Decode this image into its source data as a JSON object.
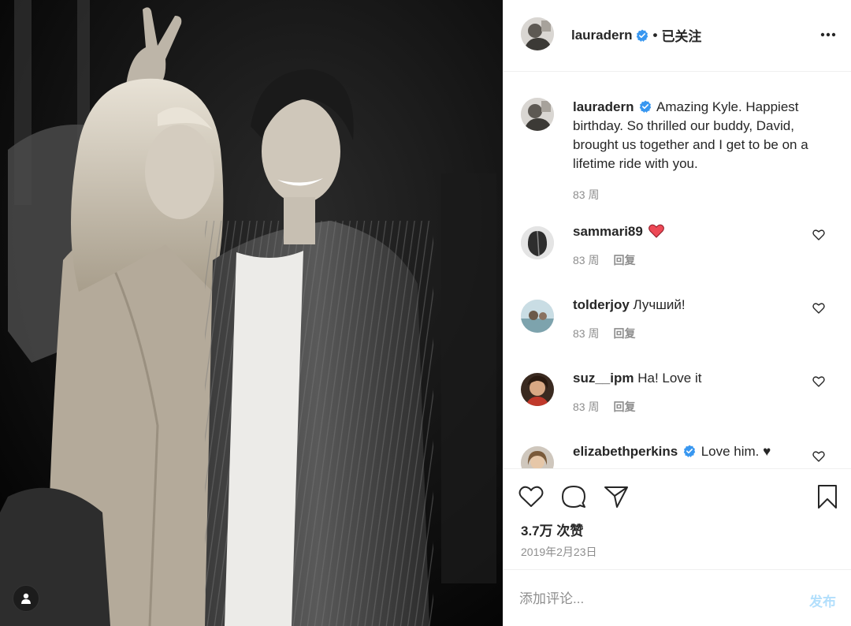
{
  "colors": {
    "verified": "#3897f0",
    "text": "#262626",
    "muted": "#8e8e8e",
    "post_disabled": "#b2dffc",
    "heart_red": "#ed4956"
  },
  "header": {
    "username": "lauradern",
    "separator": "•",
    "follow_label": "已关注",
    "more_icon": "ellipsis-icon"
  },
  "caption": {
    "username": "lauradern",
    "text": "Amazing Kyle. Happiest birthday. So thrilled our buddy, David, brought us together and I get to be on a lifetime ride with you.",
    "time": "83 周"
  },
  "comments": [
    {
      "username": "sammari89",
      "text": "",
      "emoji": "red-heart",
      "time": "83 周",
      "reply": "回复"
    },
    {
      "username": "tolderjoy",
      "text": "Лучший!",
      "time": "83 周",
      "reply": "回复"
    },
    {
      "username": "suz__ipm",
      "text": "Ha! Love it",
      "time": "83 周",
      "reply": "回复"
    },
    {
      "username": "elizabethperkins",
      "text": "Love him. ♥",
      "verified": true
    }
  ],
  "stats": {
    "likes": "3.7万 次赞",
    "date": "2019年2月23日"
  },
  "add_comment": {
    "placeholder": "添加评论...",
    "post_label": "发布"
  }
}
